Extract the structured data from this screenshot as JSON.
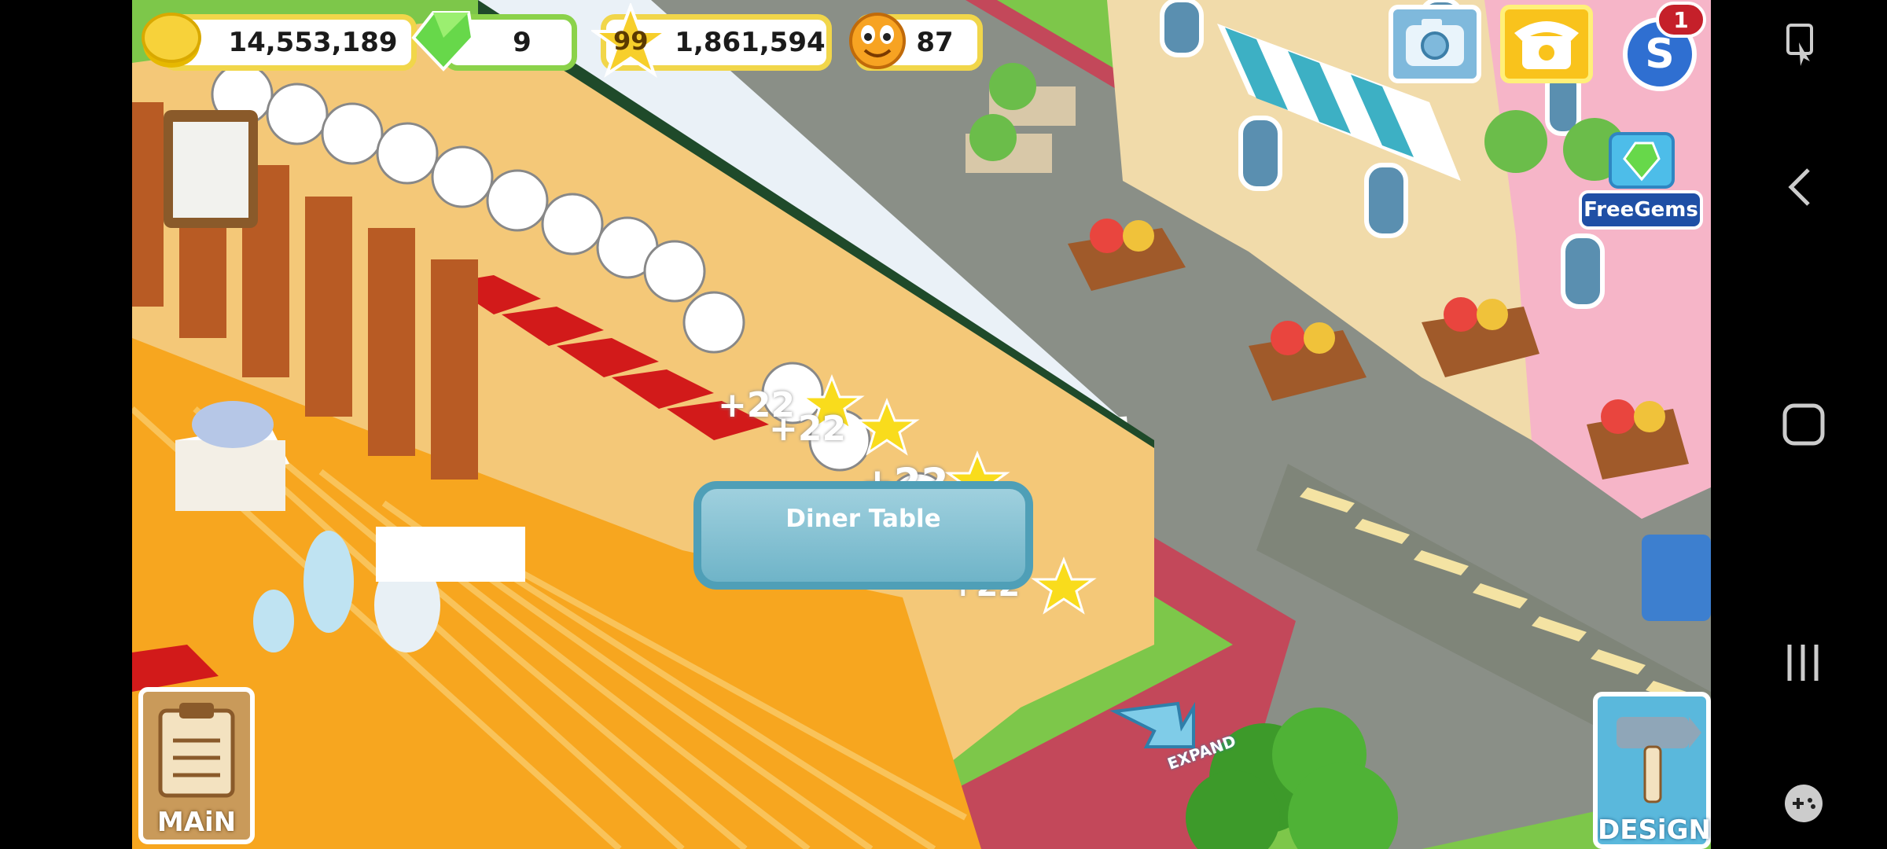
{
  "hud": {
    "coins": "14,553,189",
    "gems": "9",
    "level": "99",
    "experience": "1,861,594",
    "rating": "87",
    "notification_count": "1",
    "free_gems_label": "FreeGems"
  },
  "popup": {
    "item_name": "Diner Table"
  },
  "floating_rewards": [
    "+22",
    "+22",
    "+22",
    "+22"
  ],
  "buttons": {
    "main_label": "MAiN",
    "design_label": "DESiGN",
    "expand_label": "EXPAND"
  },
  "icons": {
    "camera": "camera-icon",
    "phone": "phone-icon",
    "social": "social-s-icon",
    "gem": "gem-icon",
    "coin": "coin-icon",
    "star": "star-icon",
    "clipboard": "clipboard-icon",
    "hammer": "hammer-icon",
    "expand_arrow": "arrow-icon"
  },
  "colors": {
    "gold_border": "#f1d64a",
    "green_border": "#8bd24a",
    "popup_bg": "#8cc6d6",
    "road": "#8a8f87",
    "grass": "#7dc74a"
  },
  "system_nav": {
    "icons": [
      "screenshot-edit-icon",
      "back-icon",
      "home-icon",
      "recents-icon",
      "game-tools-icon"
    ]
  }
}
